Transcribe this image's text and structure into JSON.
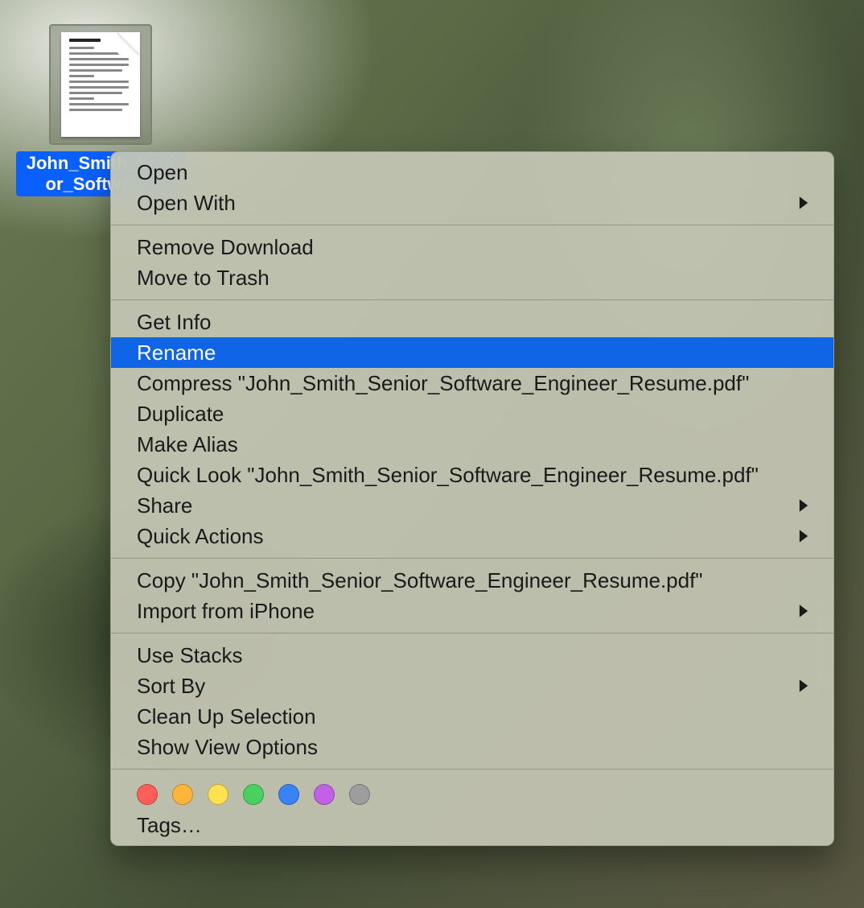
{
  "file": {
    "label_visible": "John_Smith_Senior_Softwar…",
    "full_name": "John_Smith_Senior_Software_Engineer_Resume.pdf"
  },
  "menu": {
    "highlighted_index": 5,
    "groups": [
      [
        {
          "label": "Open",
          "submenu": false
        },
        {
          "label": "Open With",
          "submenu": true
        }
      ],
      [
        {
          "label": "Remove Download",
          "submenu": false
        },
        {
          "label": "Move to Trash",
          "submenu": false
        }
      ],
      [
        {
          "label": "Get Info",
          "submenu": false
        },
        {
          "label": "Rename",
          "submenu": false
        },
        {
          "label": "Compress \"John_Smith_Senior_Software_Engineer_Resume.pdf\"",
          "submenu": false
        },
        {
          "label": "Duplicate",
          "submenu": false
        },
        {
          "label": "Make Alias",
          "submenu": false
        },
        {
          "label": "Quick Look \"John_Smith_Senior_Software_Engineer_Resume.pdf\"",
          "submenu": false
        },
        {
          "label": "Share",
          "submenu": true
        },
        {
          "label": "Quick Actions",
          "submenu": true
        }
      ],
      [
        {
          "label": "Copy \"John_Smith_Senior_Software_Engineer_Resume.pdf\"",
          "submenu": false
        },
        {
          "label": "Import from iPhone",
          "submenu": true
        }
      ],
      [
        {
          "label": "Use Stacks",
          "submenu": false
        },
        {
          "label": "Sort By",
          "submenu": true
        },
        {
          "label": "Clean Up Selection",
          "submenu": false
        },
        {
          "label": "Show View Options",
          "submenu": false
        }
      ]
    ],
    "tags": {
      "colors": [
        "#ff5f58",
        "#ffb43a",
        "#ffe24f",
        "#49d060",
        "#3a82f7",
        "#c261e6",
        "#9d9d9d"
      ],
      "label": "Tags…"
    }
  }
}
